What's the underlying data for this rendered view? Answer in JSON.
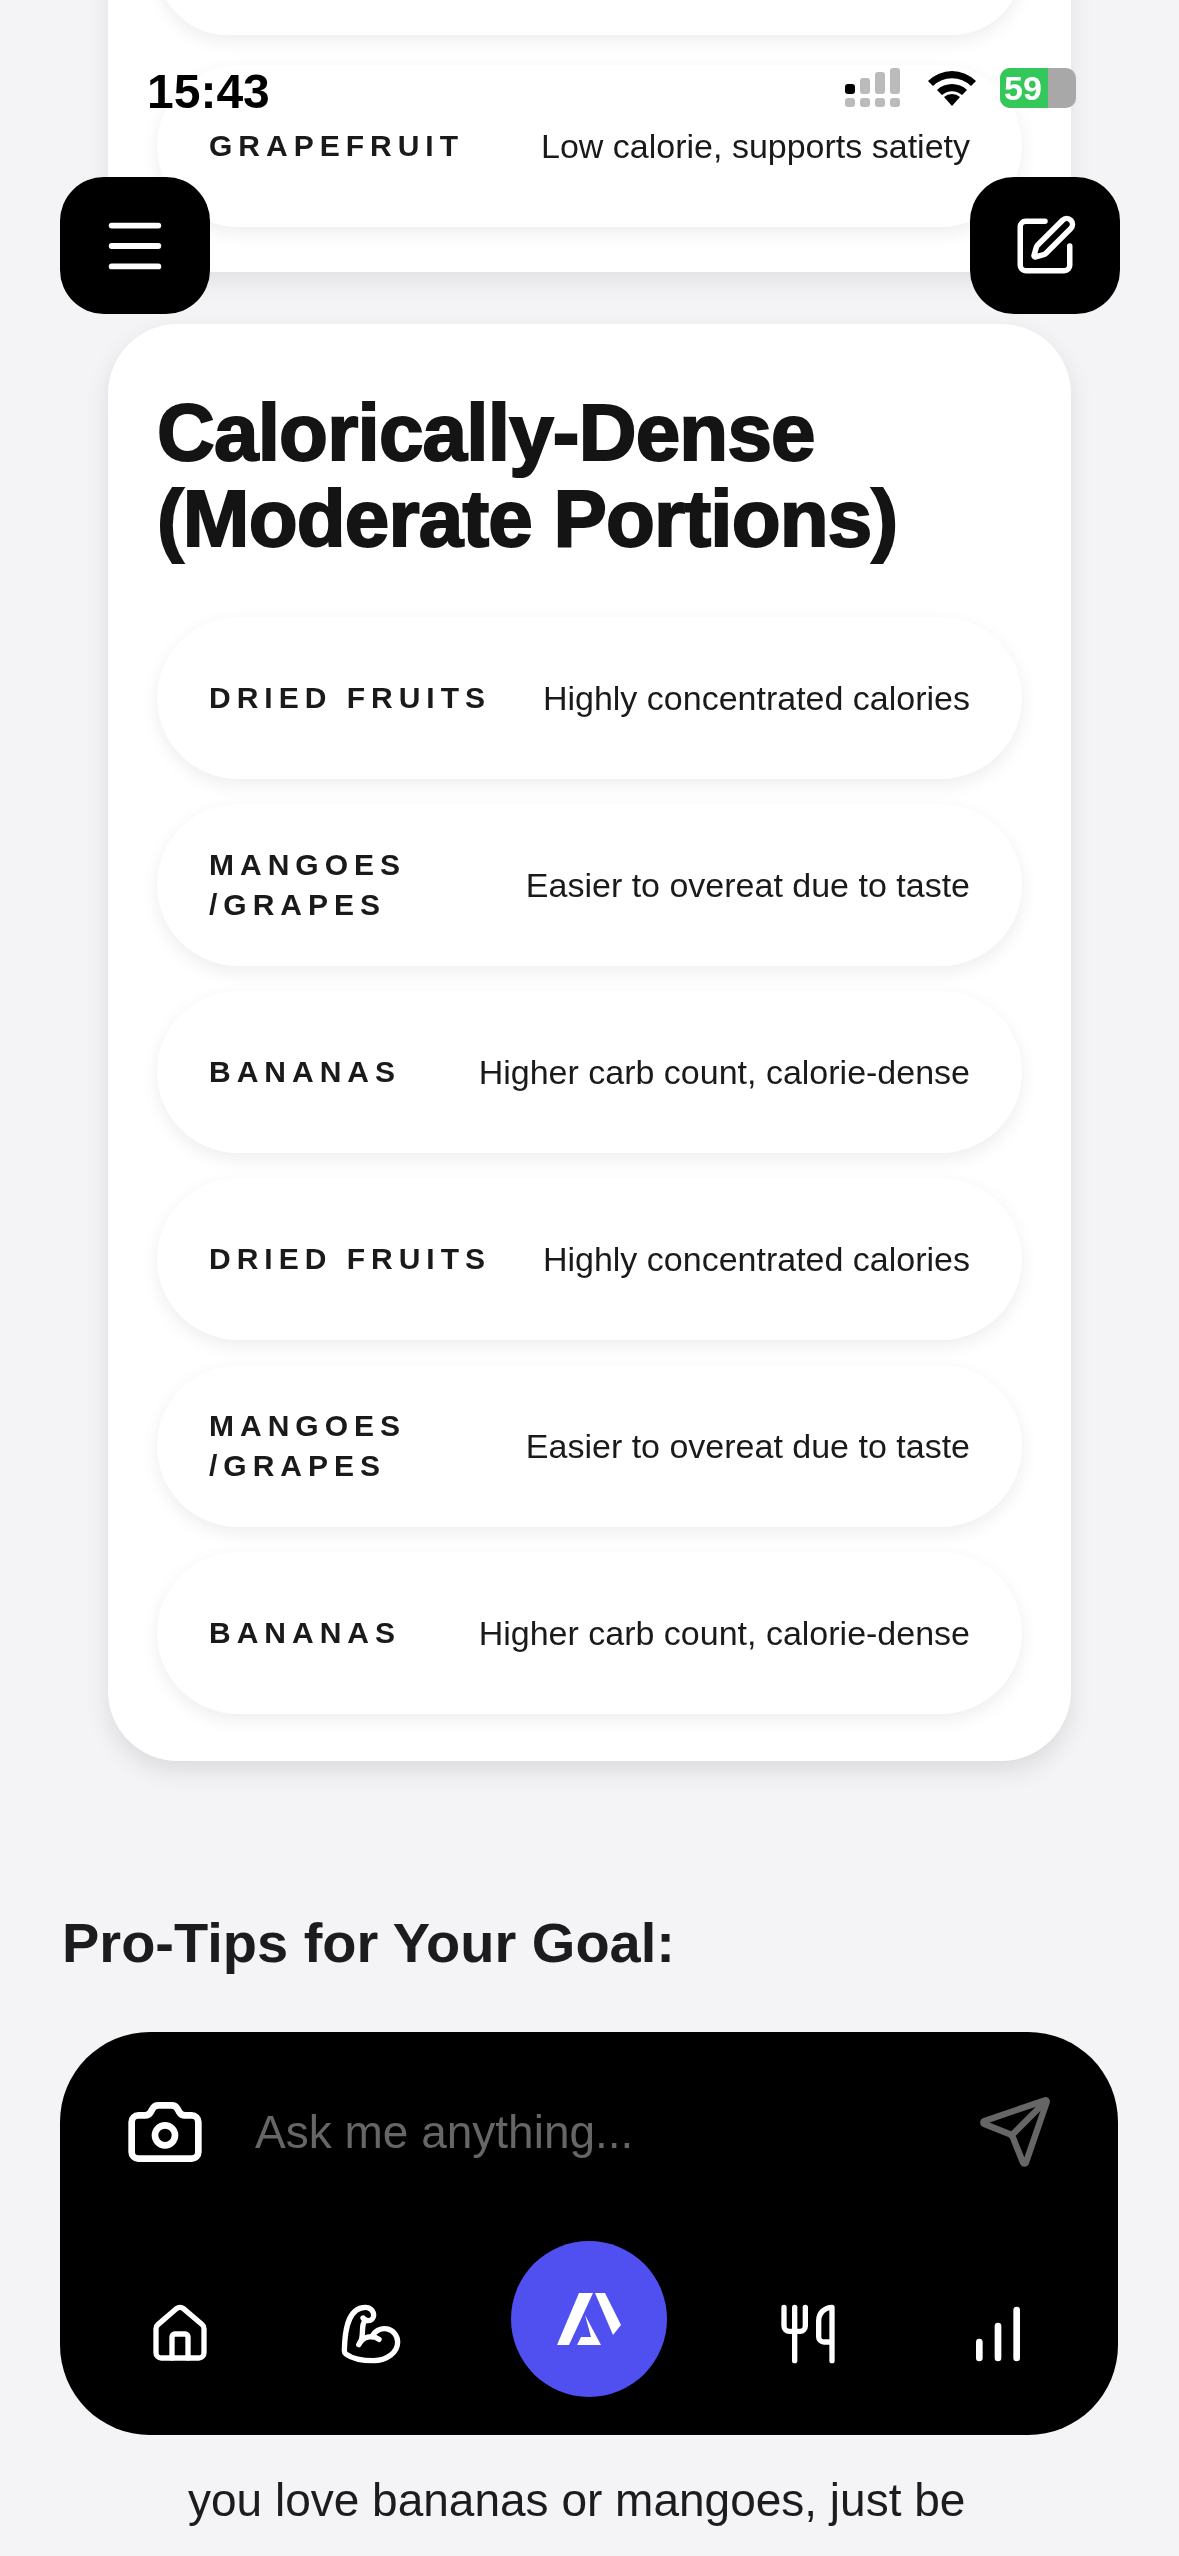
{
  "status_bar": {
    "time": "15:43",
    "battery": "59"
  },
  "previous_card": {
    "rows": [
      {
        "name": "GRAPEFRUIT",
        "note": "Low calorie, supports satiety"
      }
    ]
  },
  "card": {
    "title": "Calorically-Dense (Moderate Portions)",
    "rows": [
      {
        "name": "DRIED FRUITS",
        "note": "Highly concentrated calories"
      },
      {
        "name": "MANGOES /GRAPES",
        "note": "Easier to overeat due to taste"
      },
      {
        "name": "BANANAS",
        "note": "Higher carb count, calorie-dense"
      },
      {
        "name": "DRIED FRUITS",
        "note": "Highly concentrated calories"
      },
      {
        "name": "MANGOES /GRAPES",
        "note": "Easier to overeat due to taste"
      },
      {
        "name": "BANANAS",
        "note": "Higher carb count, calorie-dense"
      }
    ]
  },
  "section_heading": "Pro-Tips for Your Goal:",
  "paragraph_lines": [
    "you love bananas or mangoes, just be"
  ],
  "chat_input": {
    "placeholder": "Ask me anything..."
  },
  "nav": [
    {
      "selected": false
    },
    {
      "selected": false
    },
    {
      "selected": true
    },
    {
      "selected": false
    },
    {
      "selected": false
    }
  ]
}
